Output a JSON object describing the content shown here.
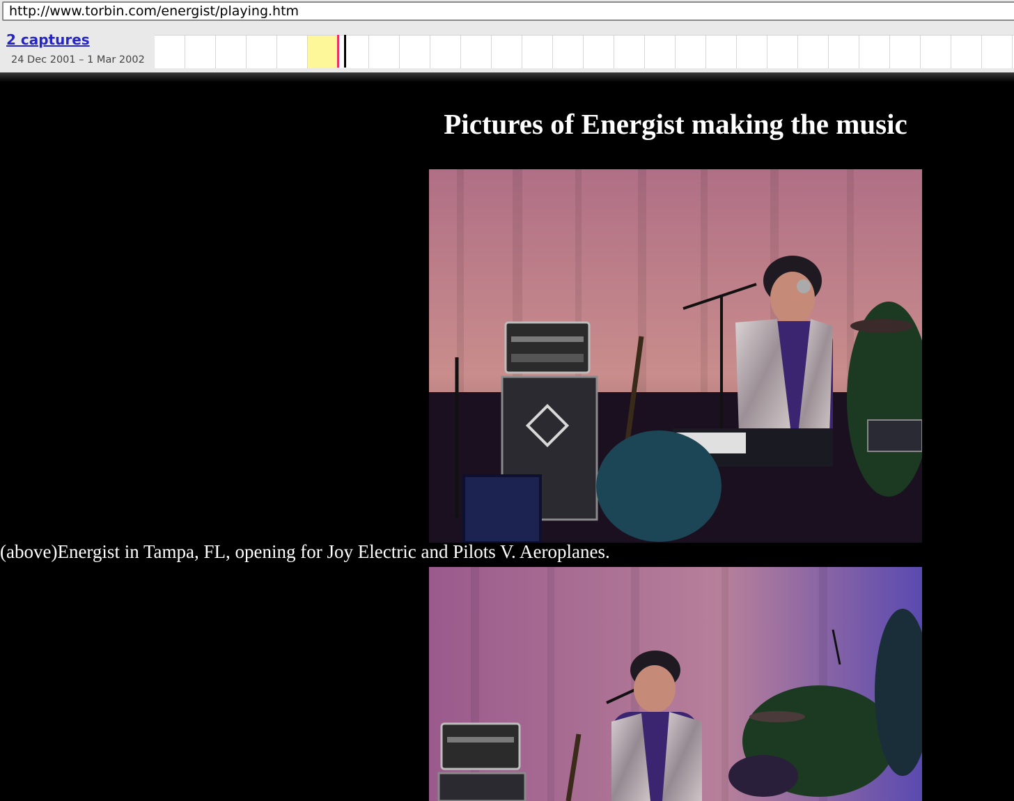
{
  "toolbar": {
    "url": "http://www.torbin.com/energist/playing.htm",
    "captures_label": "2 captures",
    "date_range": "24 Dec 2001 – 1 Mar 2002",
    "timeline_cells": 28,
    "highlight_cell_index": 5,
    "highlight_color": "#fdf79a",
    "marker_colors": [
      "#e8306c",
      "#000000"
    ]
  },
  "page": {
    "heading": "Pictures of Energist making the music",
    "photos": [
      {
        "name": "energist-on-stage-keyboard-photo"
      },
      {
        "name": "energist-singing-photo"
      }
    ],
    "caption": "(above)Energist in Tampa, FL, opening for Joy Electric and Pilots V. Aeroplanes.",
    "background_color": "#000000",
    "text_color": "#ffffff"
  }
}
